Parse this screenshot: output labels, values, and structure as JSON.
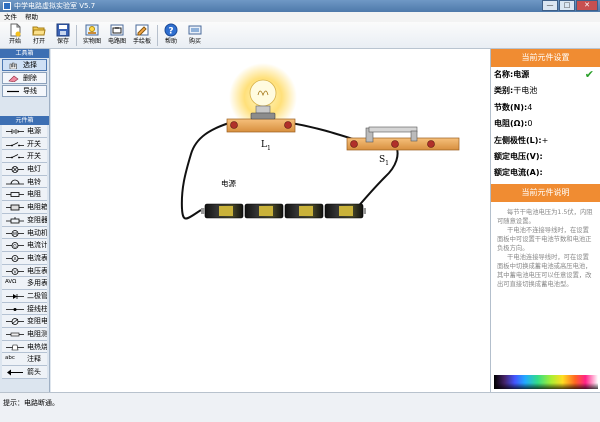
{
  "window": {
    "title": "中学电路虚拟实验室 V5.7",
    "btn_min": "—",
    "btn_max": "□",
    "btn_close": "✕"
  },
  "menu": [
    "文件",
    "帮助"
  ],
  "toolbar": [
    {
      "label": "开始",
      "icon": "new-file-icon"
    },
    {
      "label": "打开",
      "icon": "open-folder-icon"
    },
    {
      "label": "保存",
      "icon": "save-disk-icon"
    },
    {
      "label": "实物图",
      "icon": "photo-view-icon"
    },
    {
      "label": "电路图",
      "icon": "schematic-view-icon"
    },
    {
      "label": "手绘板",
      "icon": "drawing-board-icon"
    },
    {
      "label": "帮助",
      "icon": "help-icon"
    },
    {
      "label": "购买",
      "icon": "buy-icon"
    }
  ],
  "left_panel": {
    "tools_title": "工具箱",
    "tools": [
      {
        "label": "选择",
        "icon": "hand-pointer-icon"
      },
      {
        "label": "删除",
        "icon": "eraser-icon"
      },
      {
        "label": "导线",
        "icon": "wire-icon"
      }
    ],
    "components_title": "元件箱",
    "components": [
      {
        "label": "电源",
        "icon": "battery-symbol-icon"
      },
      {
        "label": "开关",
        "icon": "switch-symbol-icon"
      },
      {
        "label": "开关",
        "icon": "switch-symbol-icon"
      },
      {
        "label": "电灯",
        "icon": "lamp-symbol-icon"
      },
      {
        "label": "电铃",
        "icon": "bell-symbol-icon"
      },
      {
        "label": "电阻",
        "icon": "resistor-symbol-icon"
      },
      {
        "label": "电阻箱",
        "icon": "resistance-box-icon"
      },
      {
        "label": "变阻器",
        "icon": "rheostat-symbol-icon"
      },
      {
        "label": "电动机",
        "icon": "motor-symbol-icon"
      },
      {
        "label": "电流计",
        "icon": "galvanometer-symbol-icon"
      },
      {
        "label": "电流表",
        "icon": "ammeter-symbol-icon"
      },
      {
        "label": "电压表",
        "icon": "voltmeter-symbol-icon"
      },
      {
        "label": "多用表",
        "icon": "multimeter-icon",
        "prefix": "AVΩ"
      },
      {
        "label": "二极管",
        "icon": "diode-symbol-icon"
      },
      {
        "label": "接线柱",
        "icon": "terminal-post-icon"
      },
      {
        "label": "变阻电灯",
        "icon": "dimmer-lamp-icon"
      },
      {
        "label": "电阻测试",
        "icon": "resistance-test-icon"
      },
      {
        "label": "电热烧瓶",
        "icon": "heating-flask-icon"
      },
      {
        "label": "注释",
        "icon": "text-annotation-icon",
        "prefix": "abc"
      },
      {
        "label": "箭头",
        "icon": "arrow-icon"
      }
    ]
  },
  "canvas": {
    "lamp_label": "L",
    "lamp_sub": "1",
    "switch_label": "S",
    "switch_sub": "1",
    "battery_label": "电源"
  },
  "right_panel": {
    "settings_title": "当前元件设置",
    "props": [
      {
        "key": "名称:",
        "value": "电源",
        "bold_value": true
      },
      {
        "key": "类别:",
        "value": "干电池"
      },
      {
        "key": "节数(N):",
        "value": "4"
      },
      {
        "key": "电阻(Ω):",
        "value": "0"
      },
      {
        "key": "左侧极性(L):",
        "value": "+"
      },
      {
        "key": "额定电压(V):",
        "value": ""
      },
      {
        "key": "额定电流(A):",
        "value": ""
      }
    ],
    "desc_title": "当前元件说明",
    "desc_paragraphs": [
      "每节干电池电压为1.5伏，内阻可随意设置。",
      "干电池不连接导线时，在设置面板中可设置干电池节数和电池正负极方向。",
      "干电池连接导线时，可在设置面板中切换成蓄电池或高压电池，其中蓄电池电压可以任意设置，改出可直接切换成蓄电池型。"
    ],
    "colors": {
      "accent": "#f08c32",
      "check": "#2aa02a"
    }
  },
  "status": {
    "text": "提示：电路断通。"
  }
}
